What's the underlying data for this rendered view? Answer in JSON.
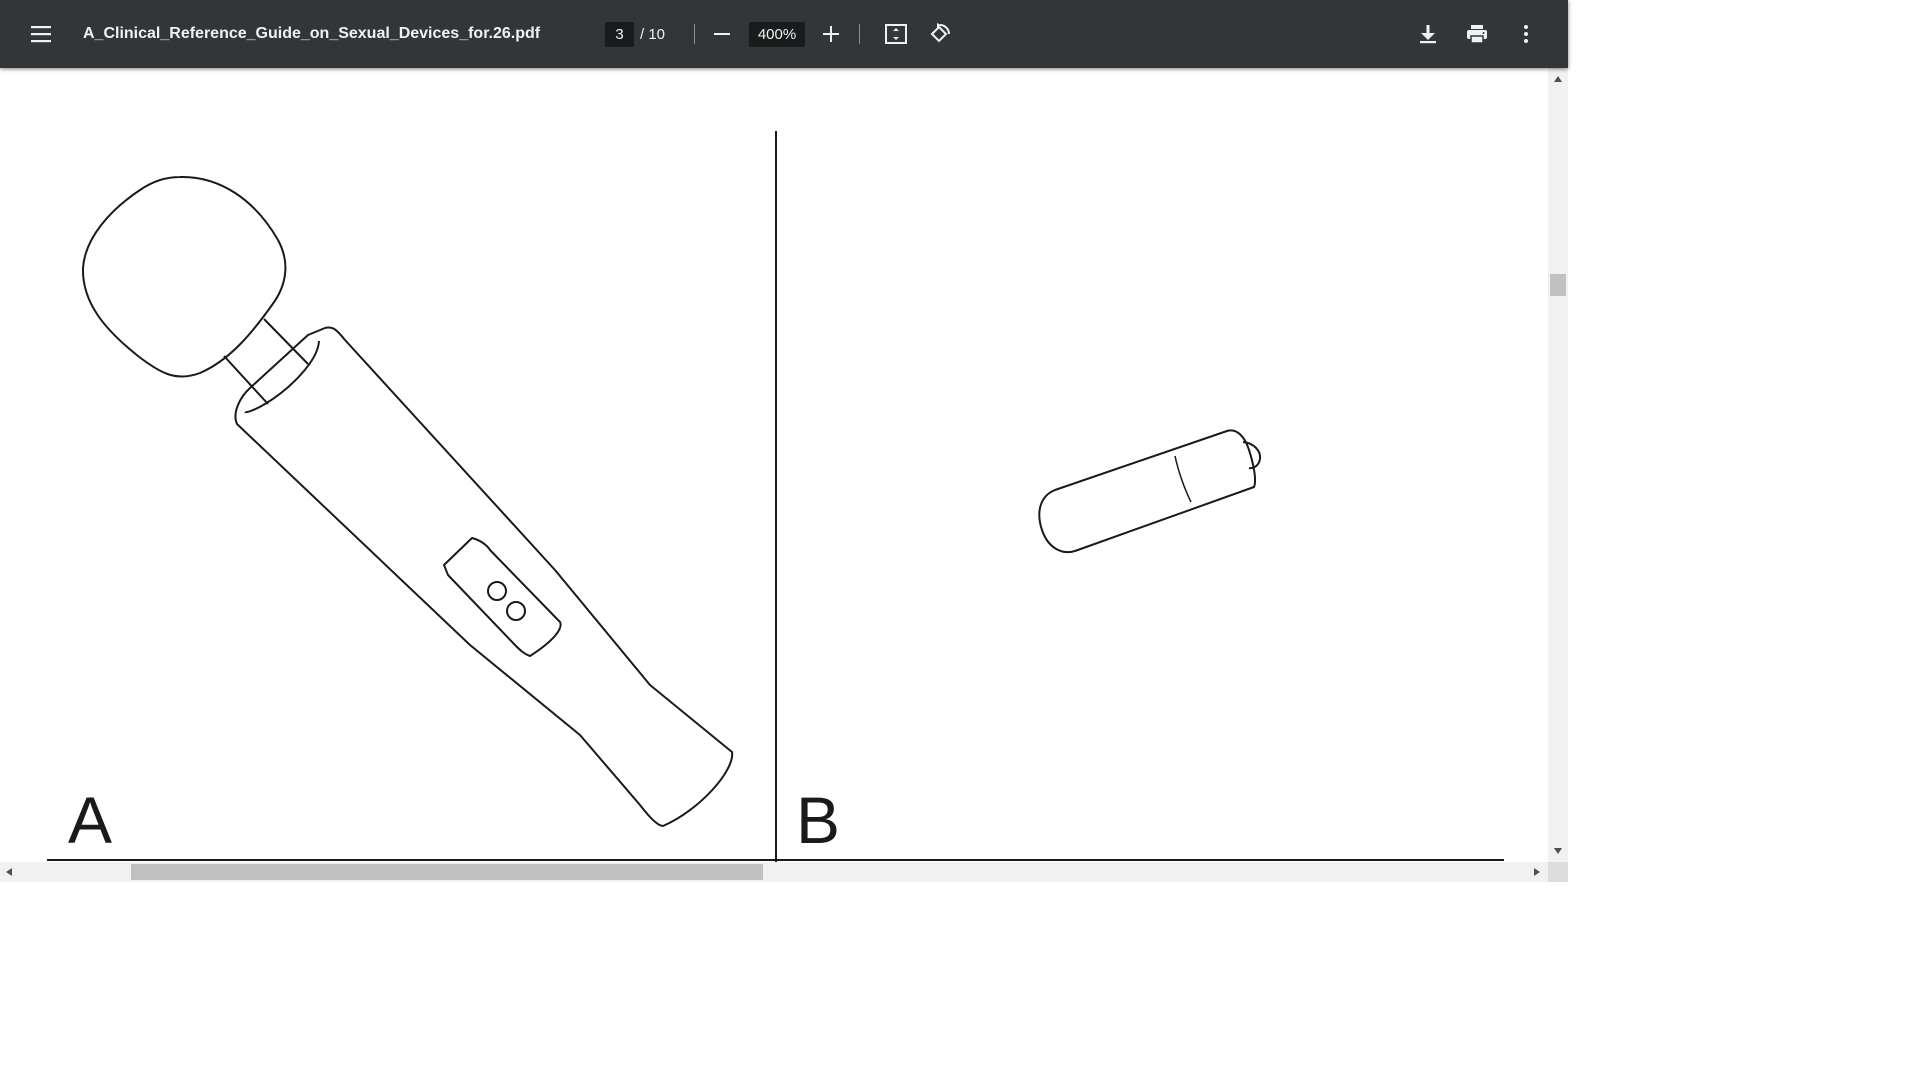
{
  "toolbar": {
    "menu_icon": "hamburger-menu-icon",
    "file_name": "A_Clinical_Reference_Guide_on_Sexual_Devices_for.26.pdf",
    "current_page": "3",
    "page_total": "/ 10",
    "zoom_out_icon": "minus-icon",
    "zoom_value": "400%",
    "zoom_in_icon": "plus-icon",
    "fit_icon": "fit-to-page-icon",
    "rotate_icon": "rotate-counterclockwise-icon",
    "download_icon": "download-icon",
    "print_icon": "print-icon",
    "more_icon": "more-vertical-icon",
    "background_color": "#323639"
  },
  "document": {
    "figure_labels": [
      "A",
      "B"
    ],
    "drawings": [
      "wand-massager-illustration",
      "bullet-vibrator-illustration"
    ]
  }
}
